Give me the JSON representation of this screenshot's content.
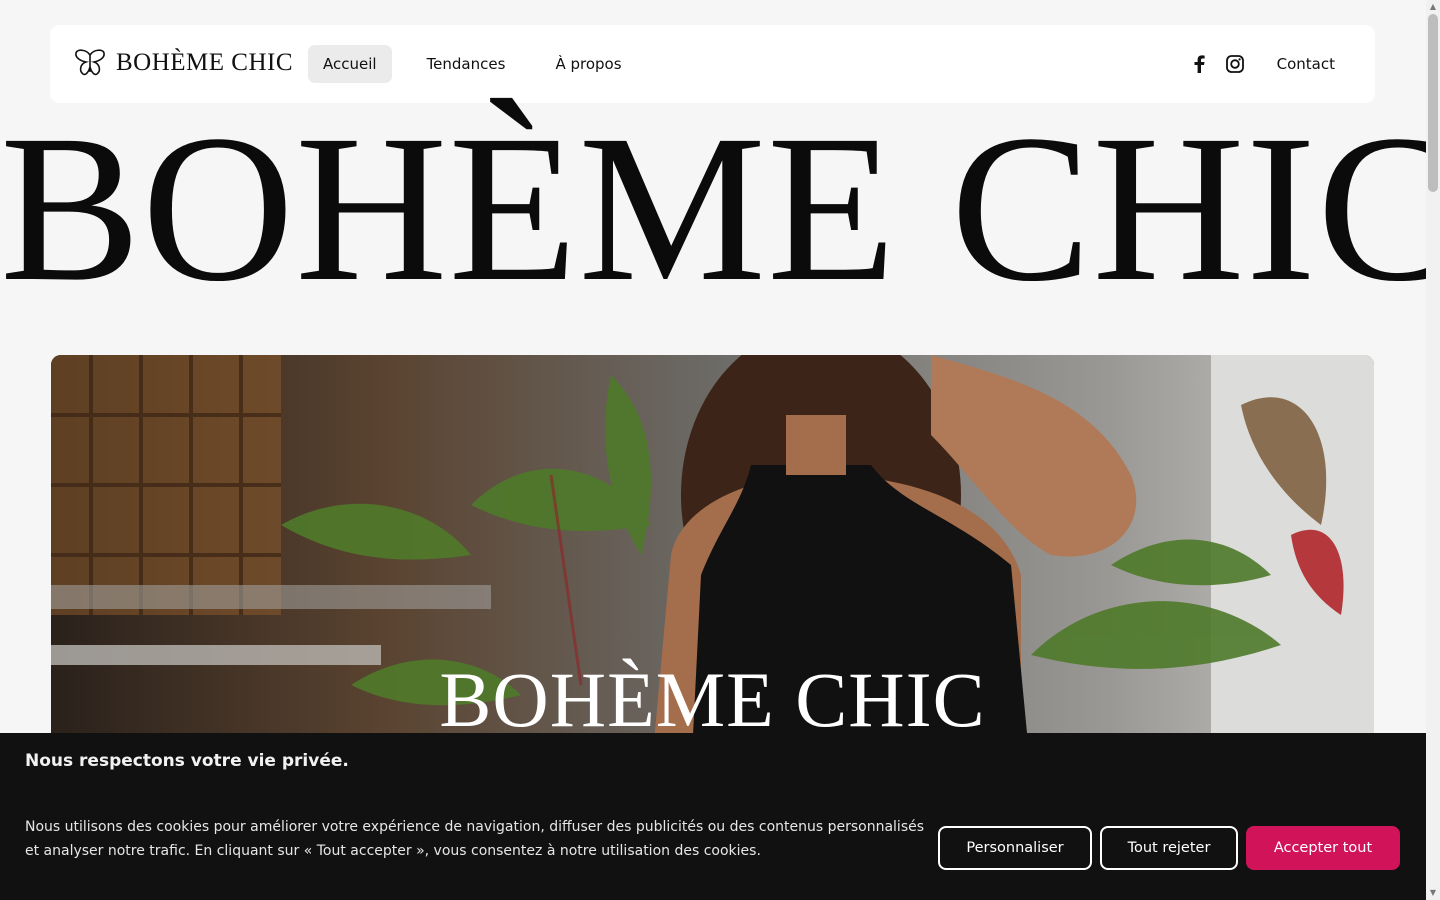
{
  "header": {
    "logo_text": "BOHÈME CHIC",
    "nav": [
      {
        "label": "Accueil",
        "active": true
      },
      {
        "label": "Tendances",
        "active": false
      },
      {
        "label": "À propos",
        "active": false
      }
    ],
    "contact_label": "Contact",
    "social_icons": [
      "facebook-icon",
      "instagram-icon"
    ]
  },
  "hero": {
    "title": "BOHÈME CHIC",
    "image_caption": "BOHÈME CHIC"
  },
  "cookie_banner": {
    "title": "Nous respectons votre vie privée.",
    "text": "Nous utilisons des cookies pour améliorer votre expérience de navigation, diffuser des publicités ou des contenus personnalisés et analyser notre trafic. En cliquant sur « Tout accepter », vous consentez à notre utilisation des cookies.",
    "customize_label": "Personnaliser",
    "reject_label": "Tout rejeter",
    "accept_label": "Accepter tout",
    "accent_color": "#d1135a"
  }
}
